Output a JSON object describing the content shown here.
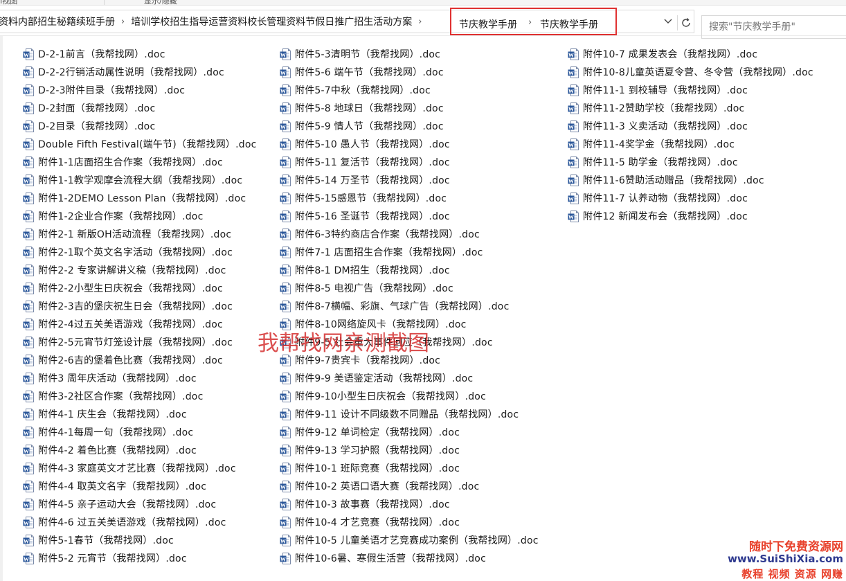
{
  "ribbon": {
    "left_fragment": "I视图",
    "right_fragment": "显示/隐藏"
  },
  "address_bar": {
    "crumbs": [
      "资料内部招生秘籍续班手册",
      "培训学校招生指导运营资料校长管理资料节假日推广招生活动方案"
    ],
    "highlighted_crumbs": [
      "节庆教学手册",
      "节庆教学手册"
    ],
    "separator": "›"
  },
  "search": {
    "placeholder": "搜索\"节庆教学手册\""
  },
  "icons": {
    "dropdown": "chevron-down-icon",
    "refresh": "refresh-icon",
    "file": "word-document-icon"
  },
  "colors": {
    "highlight_border": "#e03131",
    "word_icon_blue": "#2b579a",
    "watermark_red": "#d42a2a"
  },
  "files": {
    "column_1": [
      "D-2-1前言（我帮找网）.doc",
      "D-2-2行销活动属性说明（我帮找网）.doc",
      "D-2-3附件目录（我帮找网）.doc",
      "D-2封面（我帮找网）.doc",
      "D-2目录（我帮找网）.doc",
      "Double Fifth Festival(端午节)（我帮找网）.doc",
      "附件1-1店面招生合作案（我帮找网）.doc",
      "附件1-1教学观摩会流程大纲（我帮找网）.doc",
      "附件1-2DEMO Lesson Plan（我帮找网）.doc",
      "附件1-2企业合作案（我帮找网）.doc",
      "附件2-1 新版OH活动流程（我帮找网）.doc",
      "附件2-1取个英文名字活动（我帮找网）.doc",
      "附件2-2 专家讲解讲义稿（我帮找网）.doc",
      "附件2-2小型生日庆祝会（我帮找网）.doc",
      "附件2-3吉的堡庆祝生日会（我帮找网）.doc",
      "附件2-4过五关美语游戏（我帮找网）.doc",
      "附件2-5元宵节灯笼设计展（我帮找网）.doc",
      "附件2-6吉的堡着色比赛（我帮找网）.doc",
      "附件3 周年庆活动（我帮找网）.doc",
      "附件3-2社区合作案（我帮找网）.doc",
      "附件4-1 庆生会（我帮找网）.doc",
      "附件4-1每周一句（我帮找网）.doc",
      "附件4-2 着色比赛（我帮找网）.doc",
      "附件4-3 家庭英文才艺比赛（我帮找网）.doc",
      "附件4-4 取英文名字（我帮找网）.doc",
      "附件4-5 亲子运动大会（我帮找网）.doc",
      "附件4-6 过五关美语游戏（我帮找网）.doc",
      "附件5-1春节（我帮找网）.doc",
      "附件5-2 元宵节（我帮找网）.doc"
    ],
    "column_2": [
      "附件5-3清明节（我帮找网）.doc",
      "附件5-6 端午节（我帮找网）.doc",
      "附件5-7中秋（我帮找网）.doc",
      "附件5-8 地球日（我帮找网）.doc",
      "附件5-9 情人节（我帮找网）.doc",
      "附件5-10 愚人节（我帮找网）.doc",
      "附件5-11 复活节（我帮找网）.doc",
      "附件5-14 万圣节（我帮找网）.doc",
      "附件5-15感恩节（我帮找网）.doc",
      "附件5-16 圣诞节（我帮找网）.doc",
      "附件6-3特约商店合作案（我帮找网）.doc",
      "附件7-1 店面招生合作案（我帮找网）.doc",
      "附件8-1 DM招生（我帮找网）.doc",
      "附件8-5 电视广告（我帮找网）.doc",
      "附件8-7横幅、彩旗、气球广告（我帮找网）.doc",
      "附件8-10网络旋风卡（我帮找网）.doc",
      "附件9-5 社会重大事件回应（我帮找网）.doc",
      "附件9-7贵宾卡（我帮找网）.doc",
      "附件9-9 美语鉴定活动（我帮找网）.doc",
      "附件9-10小型生日庆祝会（我帮找网）.doc",
      "附件9-11 设计不同级数不同赠品（我帮找网）.doc",
      "附件9-12 单词检定（我帮找网）.doc",
      "附件9-13 学习护照（我帮找网）.doc",
      "附件10-1 班际竞赛（我帮找网）.doc",
      "附件10-2 英语口语大赛（我帮找网）.doc",
      "附件10-3 故事赛（我帮找网）.doc",
      "附件10-4 才艺竞赛（我帮找网）.doc",
      "附件10-5 儿童美语才艺竞赛成功案例（我帮找网）.doc",
      "附件10-6暑、寒假生活营（我帮找网）.doc"
    ],
    "column_3": [
      "附件10-7 成果发表会（我帮找网）.doc",
      "附件10-8儿童英语夏令营、冬令营（我帮找网）.doc",
      "附件11-1 到校辅导（我帮找网）.doc",
      "附件11-2赞助学校（我帮找网）.doc",
      "附件11-3 义卖活动（我帮找网）.doc",
      "附件11-4奖学金（我帮找网）.doc",
      "附件11-5 助学金（我帮找网）.doc",
      "附件11-6赞助活动赠品（我帮找网）.doc",
      "附件11-7 认养动物（我帮找网）.doc",
      "附件12 新闻发布会（我帮找网）.doc"
    ]
  },
  "watermark": {
    "center_text": "我帮找网亲测截图"
  },
  "logo_watermark": {
    "line1": "随时下免费资源网",
    "line2": "www.SuiShiXia.com",
    "line3": "教程 视频 资源 网赚"
  }
}
